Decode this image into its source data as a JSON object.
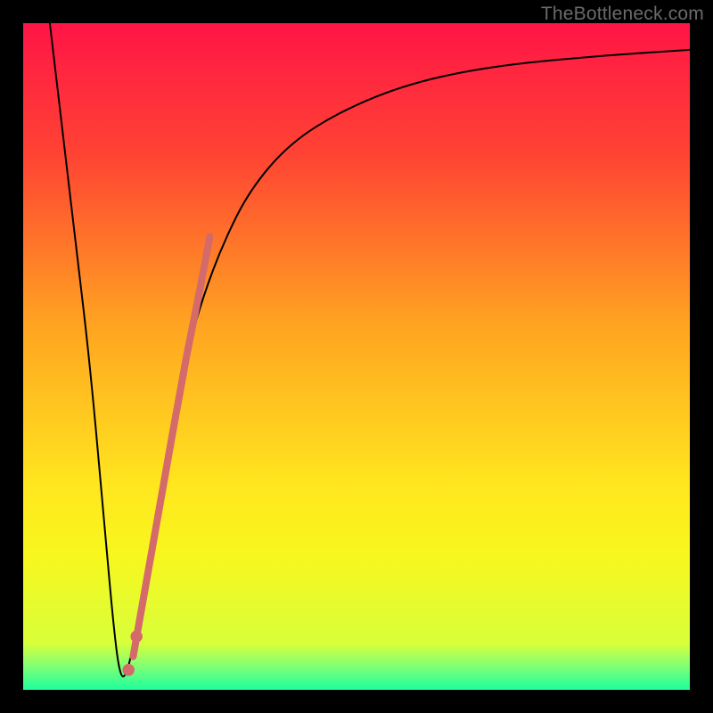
{
  "watermark": "TheBottleneck.com",
  "chart_data": {
    "type": "line",
    "title": "",
    "xlabel": "",
    "ylabel": "",
    "xlim": [
      0,
      100
    ],
    "ylim": [
      0,
      100
    ],
    "grid": false,
    "legend": false,
    "gradient_stops": [
      {
        "pct": 0,
        "color": "#ff1546"
      },
      {
        "pct": 20,
        "color": "#ff4433"
      },
      {
        "pct": 45,
        "color": "#ffa321"
      },
      {
        "pct": 70,
        "color": "#ffe81e"
      },
      {
        "pct": 80,
        "color": "#f7f71e"
      },
      {
        "pct": 93,
        "color": "#d8ff3a"
      },
      {
        "pct": 96,
        "color": "#8dff6e"
      },
      {
        "pct": 100,
        "color": "#1dff9f"
      }
    ],
    "series": [
      {
        "name": "bottleneck-curve",
        "stroke": "#000000",
        "x": [
          4,
          6,
          8,
          10,
          12,
          13.5,
          14.5,
          15.5,
          17,
          19,
          21,
          23,
          25,
          27,
          30,
          34,
          40,
          48,
          58,
          70,
          85,
          100
        ],
        "y": [
          100,
          83,
          66,
          49,
          27,
          10,
          2,
          2,
          9,
          20,
          33,
          43,
          52,
          59,
          67,
          75,
          82,
          87,
          91,
          93.5,
          95,
          96
        ]
      }
    ],
    "highlight_segment": {
      "name": "coral-highlight",
      "stroke": "#d46a6a",
      "x": [
        16.5,
        19.5,
        22.5,
        24.5,
        26.5,
        28.0
      ],
      "y": [
        5,
        22,
        39,
        50,
        60,
        68
      ]
    },
    "highlight_dots": {
      "name": "coral-dots",
      "fill": "#d46a6a",
      "points": [
        {
          "x": 17.0,
          "y": 8
        },
        {
          "x": 15.8,
          "y": 3
        }
      ]
    }
  }
}
